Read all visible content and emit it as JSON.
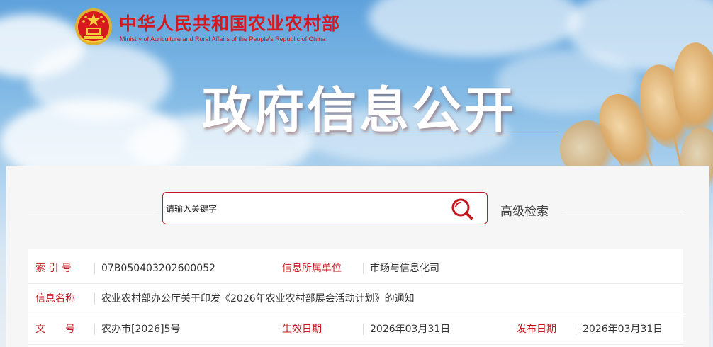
{
  "header": {
    "site_title": "中华人民共和国农业农村部",
    "site_subtitle": "Ministry of Agriculture and Rural Affairs of the People's Republic of China",
    "hero_title": "政府信息公开"
  },
  "search": {
    "placeholder": "请输入关键字",
    "advanced_label": "高级检索"
  },
  "colors": {
    "accent": "#c4161c",
    "emblem_red": "#d6181f"
  },
  "info_table": {
    "row1": {
      "label1": "索 引 号",
      "value1": "07B050403202600052",
      "label2": "信息所属单位",
      "value2": "市场与信息化司"
    },
    "row2": {
      "label1": "信息名称",
      "value1": "农业农村部办公厅关于印发《2026年农业农村部展会活动计划》的通知"
    },
    "row3": {
      "label1": "文　　号",
      "value1": "农办市[2026]5号",
      "label2": "生效日期",
      "value2": "2026年03月31日",
      "label3": "发布日期",
      "value3": "2026年03月31日"
    }
  }
}
